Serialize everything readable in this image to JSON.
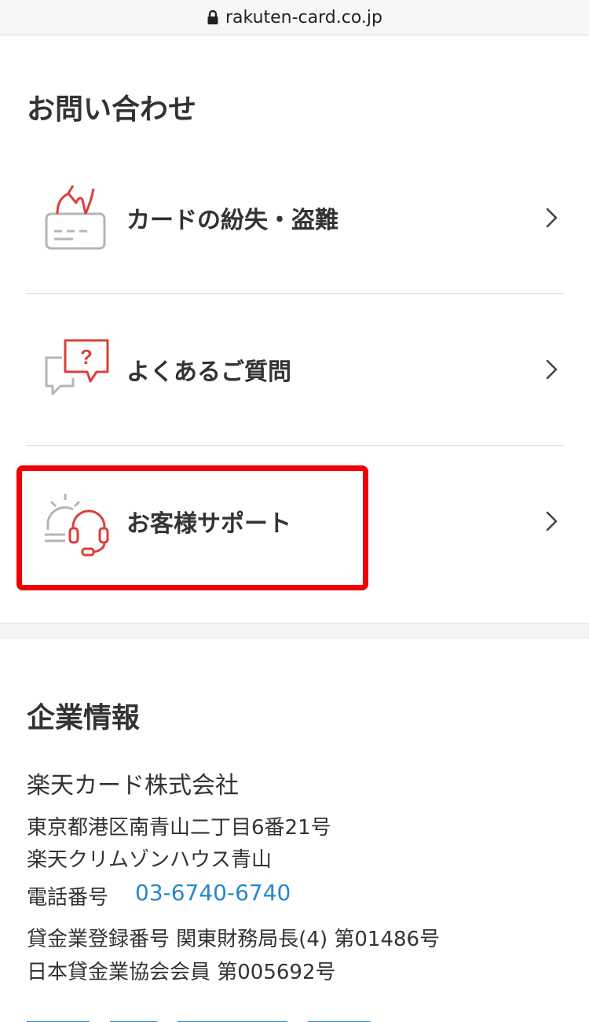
{
  "browser": {
    "url": "rakuten-card.co.jp"
  },
  "contact": {
    "title": "お問い合わせ",
    "items": [
      {
        "label": "カードの紛失・盗難",
        "icon": "lost-card-icon"
      },
      {
        "label": "よくあるご質問",
        "icon": "faq-chat-icon"
      },
      {
        "label": "お客様サポート",
        "icon": "customer-support-headset-icon"
      }
    ]
  },
  "company": {
    "title": "企業情報",
    "name": "楽天カード株式会社",
    "address_line1": "東京都港区南青山二丁目6番21号",
    "address_line2": "楽天クリムゾンハウス青山",
    "phone_label": "電話番号",
    "phone_number": "03-6740-6740",
    "registration": "貸金業登録番号 関東財務局長(4) 第01486号",
    "association": "日本貸金業協会会員 第005692号"
  },
  "colors": {
    "accent_red": "#d9403a",
    "highlight": "#f00000",
    "link": "#2a86c9",
    "icon_gray": "#b5b5b5"
  }
}
